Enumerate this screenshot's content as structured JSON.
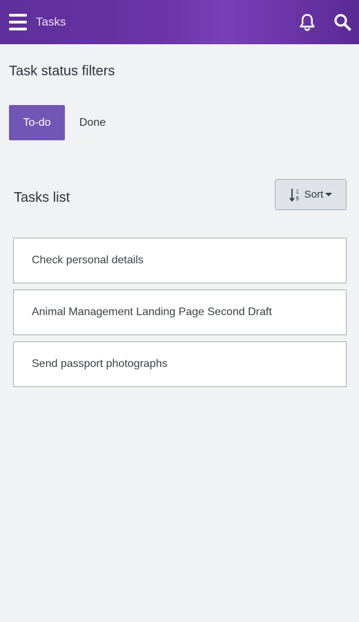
{
  "app_bar": {
    "title": "Tasks",
    "menu_icon": "hamburger-menu-icon",
    "bell_icon": "bell-icon",
    "search_icon": "search-icon",
    "background_colors": [
      "#5e2f9a",
      "#7a3fb8"
    ]
  },
  "filters": {
    "heading": "Task status filters",
    "todo_label": "To-do",
    "done_label": "Done",
    "selected": "To-do",
    "accent_color": "#7156b5"
  },
  "tasks_list": {
    "heading": "Tasks list",
    "sort_label": "Sort",
    "sort_icon": "sort-numeric-ascending-icon",
    "items": [
      {
        "label": "Check personal details"
      },
      {
        "label": "Animal Management Landing Page Second Draft"
      },
      {
        "label": "Send passport photographs"
      }
    ]
  }
}
